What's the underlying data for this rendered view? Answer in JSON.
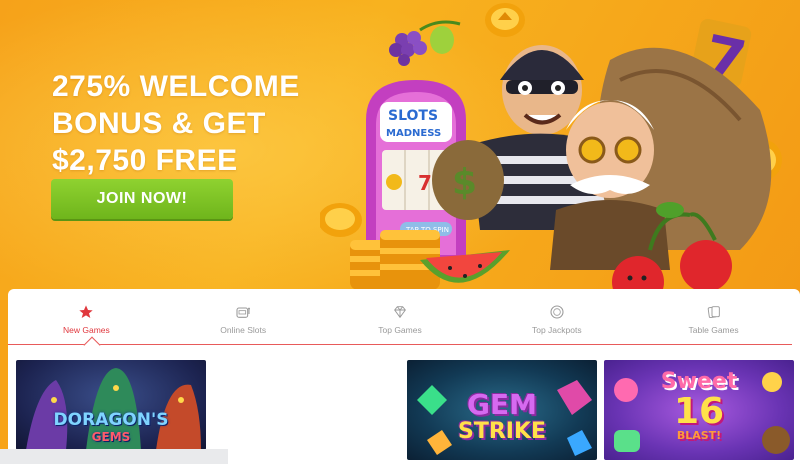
{
  "hero": {
    "headline_lines": [
      "275% WELCOME",
      "BONUS & GET",
      "$2,750 FREE"
    ],
    "cta_label": "JOIN NOW!",
    "slot_sign": [
      "SLOTS",
      "MADNESS"
    ],
    "tap_label": "TAP TO SPIN",
    "seven": "7"
  },
  "tabs": [
    {
      "label": "New Games",
      "icon": "star-icon",
      "active": true
    },
    {
      "label": "Online Slots",
      "icon": "slot-machine-icon",
      "active": false
    },
    {
      "label": "Top Games",
      "icon": "diamond-icon",
      "active": false
    },
    {
      "label": "Top Jackpots",
      "icon": "coin-icon",
      "active": false
    },
    {
      "label": "Table Games",
      "icon": "cards-icon",
      "active": false
    }
  ],
  "games": [
    {
      "title_line1": "DORAGON'S",
      "title_line2": "GEMS"
    },
    {
      "title_line1": "GEM",
      "title_line2": "STRIKE"
    },
    {
      "title_line1": "Sweet",
      "title_line2": "16",
      "title_line3": "BLAST!"
    }
  ],
  "colors": {
    "accent": "#e0383e",
    "cta": "#7cc425",
    "hero_bg": "#f6a21a"
  }
}
